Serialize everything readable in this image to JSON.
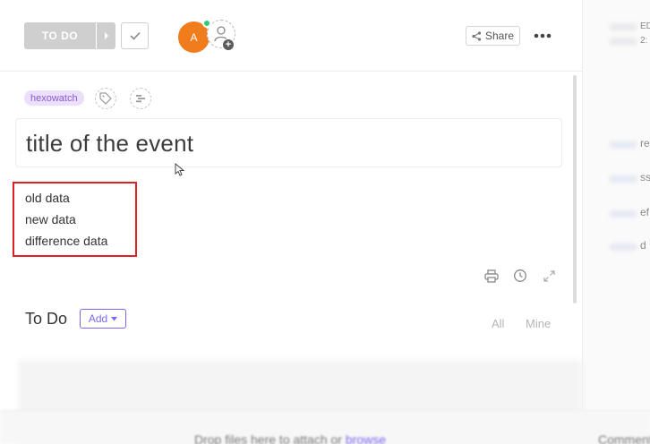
{
  "toolbar": {
    "status_label": "TO DO",
    "avatar_initial": "A",
    "share_label": "Share"
  },
  "tags": {
    "tag_label": "hexowatch"
  },
  "task": {
    "title": "title of the event",
    "description_lines": [
      "old data",
      "new data",
      "difference data"
    ]
  },
  "todo": {
    "heading": "To Do",
    "add_label": "Add",
    "filter_all": "All",
    "filter_mine": "Mine"
  },
  "right_panel": {
    "header_text_1": "ED",
    "header_text_2": "2:",
    "items": [
      "re",
      "ss",
      "ef",
      "d"
    ]
  },
  "attach": {
    "drop_text": "Drop files here to attach or ",
    "browse_link": "browse",
    "comment_hint": "Comment"
  },
  "colors": {
    "accent": "#7b68ee",
    "status_gray": "#cfcfcf",
    "avatar_orange": "#f07c1b",
    "online_green": "#2ecd6f",
    "tag_bg": "#ecdffb",
    "tag_text": "#8a5bd1",
    "highlight_red": "#e02020"
  },
  "icons": [
    "chevron-right-icon",
    "checkmark-icon",
    "add-user-icon",
    "plus-icon",
    "share-icon",
    "more-icon",
    "tag-icon",
    "list-icon",
    "print-icon",
    "history-icon",
    "expand-icon",
    "caret-down-icon",
    "pointer-cursor-icon"
  ]
}
